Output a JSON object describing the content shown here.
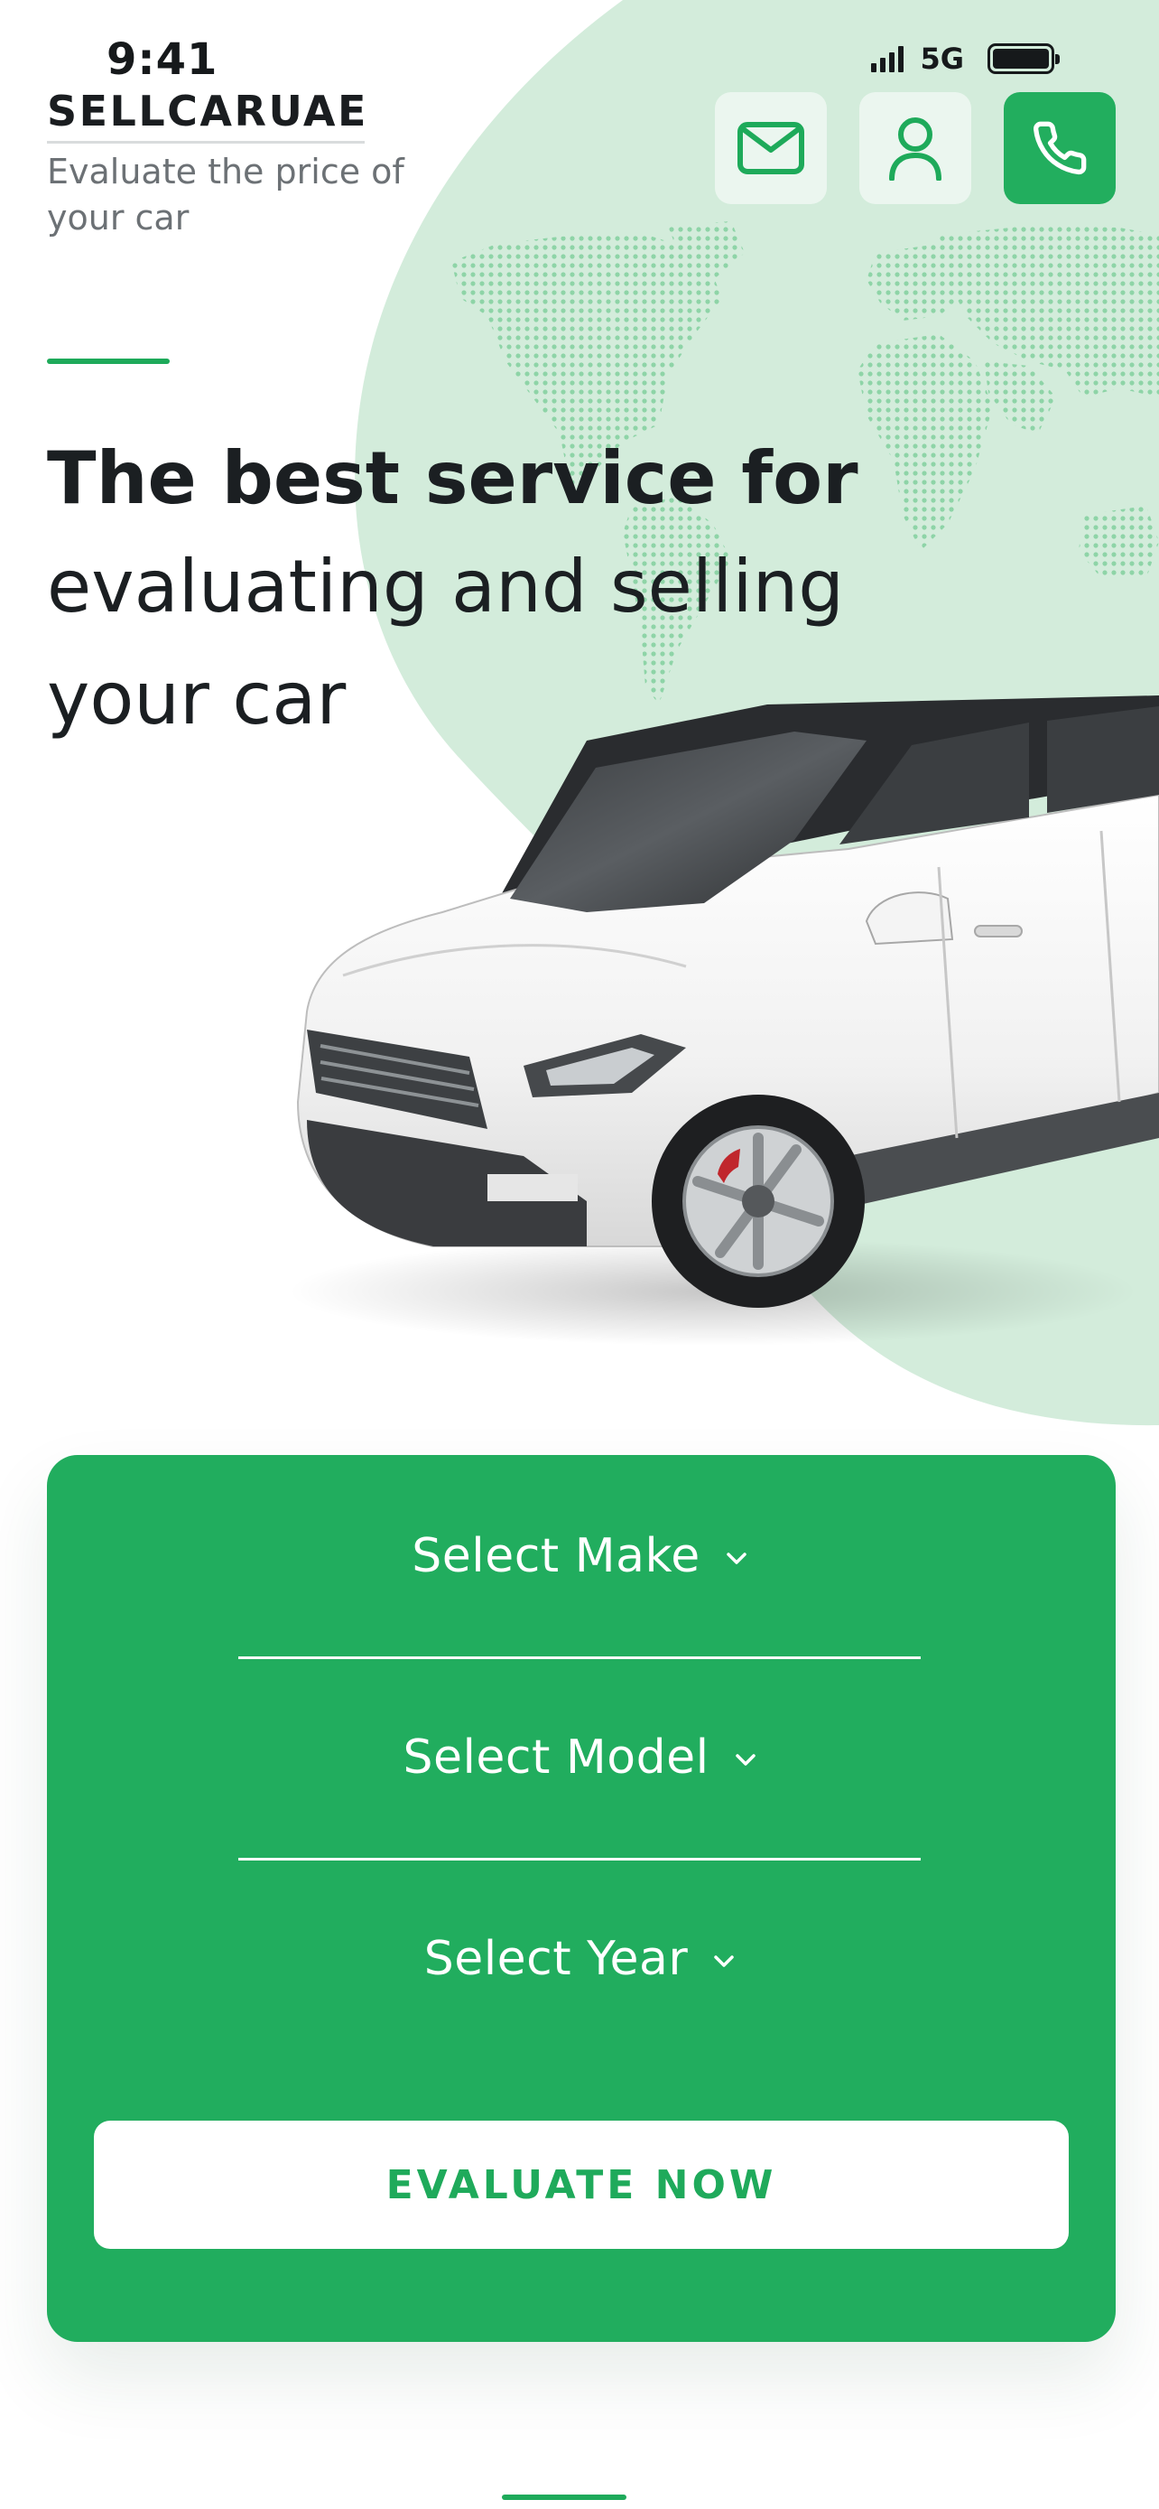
{
  "status_bar": {
    "time": "9:41",
    "network": "5G"
  },
  "brand": {
    "name": "SELLCARUAE",
    "tagline": "Evaluate the price of your car"
  },
  "header": {
    "actions": [
      {
        "icon": "mail-icon"
      },
      {
        "icon": "user-icon"
      },
      {
        "icon": "phone-icon"
      }
    ]
  },
  "hero": {
    "headline_bold": "The best service for",
    "headline_line2": "evaluating and selling",
    "headline_line3": "your car"
  },
  "form": {
    "make_label": "Select Make",
    "model_label": "Select Model",
    "year_label": "Select Year",
    "submit_label": "EVALUATE NOW"
  },
  "colors": {
    "accent": "#21ad5e",
    "accent_light": "#d4ecdc",
    "text_dark": "#1b1f22",
    "text_muted": "#6c7175"
  }
}
